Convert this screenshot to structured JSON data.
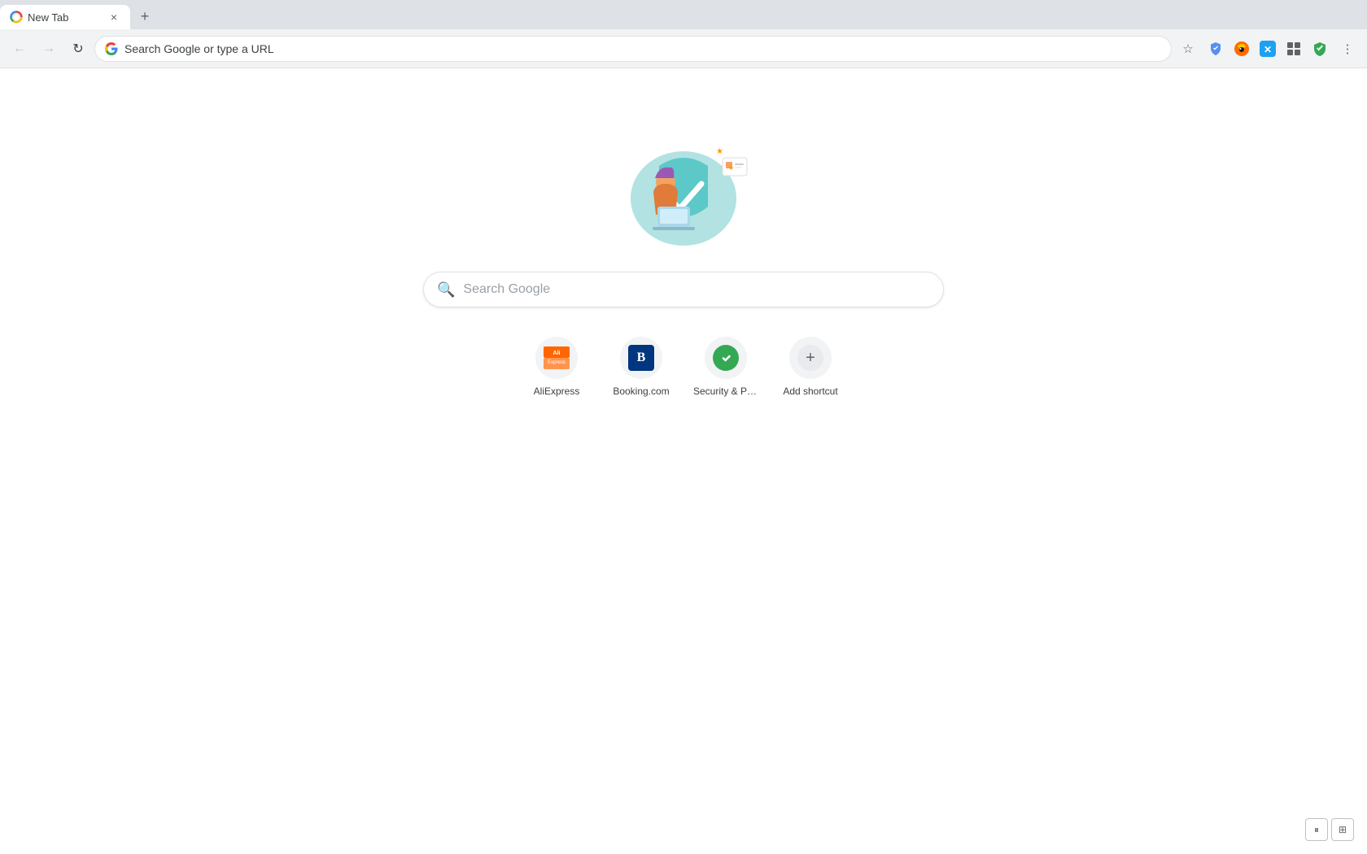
{
  "tab": {
    "title": "New Tab",
    "close_label": "×"
  },
  "tab_new_label": "+",
  "toolbar": {
    "back_label": "←",
    "forward_label": "→",
    "refresh_label": "↻",
    "address_placeholder": "Search Google or type a URL",
    "bookmark_label": "☆",
    "menu_label": "⋮"
  },
  "search": {
    "placeholder": "Search Google"
  },
  "shortcuts": [
    {
      "id": "aliexpress",
      "label": "AliExpress"
    },
    {
      "id": "booking",
      "label": "Booking.com"
    },
    {
      "id": "security",
      "label": "Security & Priv..."
    },
    {
      "id": "add",
      "label": "Add shortcut"
    }
  ],
  "colors": {
    "booking_bg": "#003580",
    "security_bg": "#34a853",
    "google_blue": "#4285f4"
  }
}
